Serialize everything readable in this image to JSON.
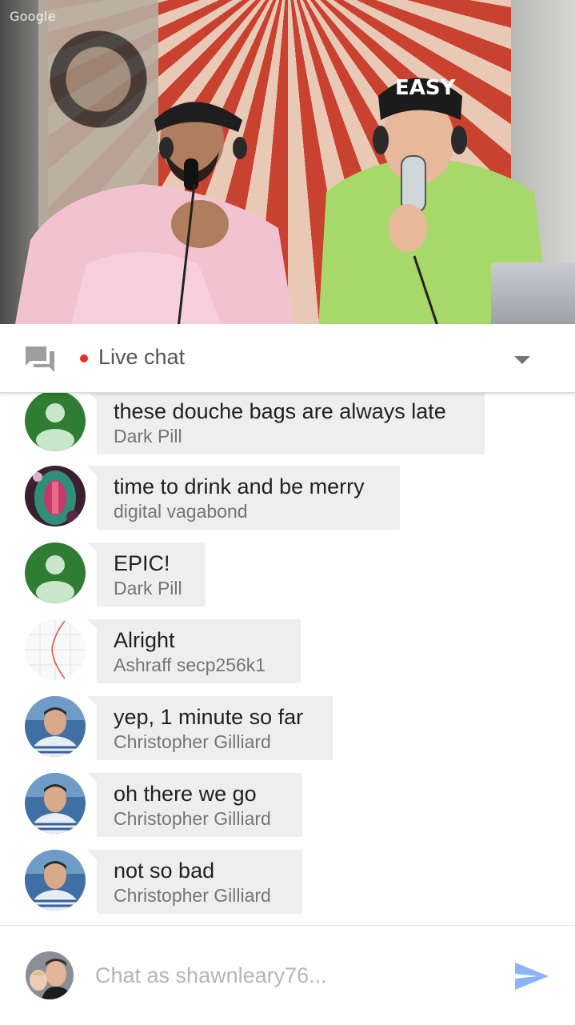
{
  "video": {
    "watermark": "Google",
    "hat_text": "EASY"
  },
  "chat_header": {
    "title": "Live chat",
    "icons": {
      "left": "forum-icon",
      "live": "live-dot",
      "right": "dropdown-arrow-icon"
    },
    "live_color": "#e52d27"
  },
  "messages": [
    {
      "text": "these douche bags are always late",
      "author": "Dark Pill",
      "avatar": "default-green"
    },
    {
      "text": "time to drink and be merry",
      "author": "digital vagabond",
      "avatar": "artwork"
    },
    {
      "text": "EPIC!",
      "author": "Dark Pill",
      "avatar": "default-green"
    },
    {
      "text": "Alright",
      "author": "Ashraff secp256k1",
      "avatar": "curve"
    },
    {
      "text": "yep, 1 minute so far",
      "author": "Christopher Gilliard",
      "avatar": "photo"
    },
    {
      "text": "oh there we go",
      "author": "Christopher Gilliard",
      "avatar": "photo"
    },
    {
      "text": "not so bad",
      "author": "Christopher Gilliard",
      "avatar": "photo"
    }
  ],
  "composer": {
    "placeholder": "Chat as shawnleary76...",
    "send_icon": "send-icon",
    "send_color": "#8ab4f8"
  },
  "colors": {
    "bubble": "#eeeeee",
    "default_avatar": "#2e7d32",
    "text": "#212121",
    "author": "#757575"
  }
}
